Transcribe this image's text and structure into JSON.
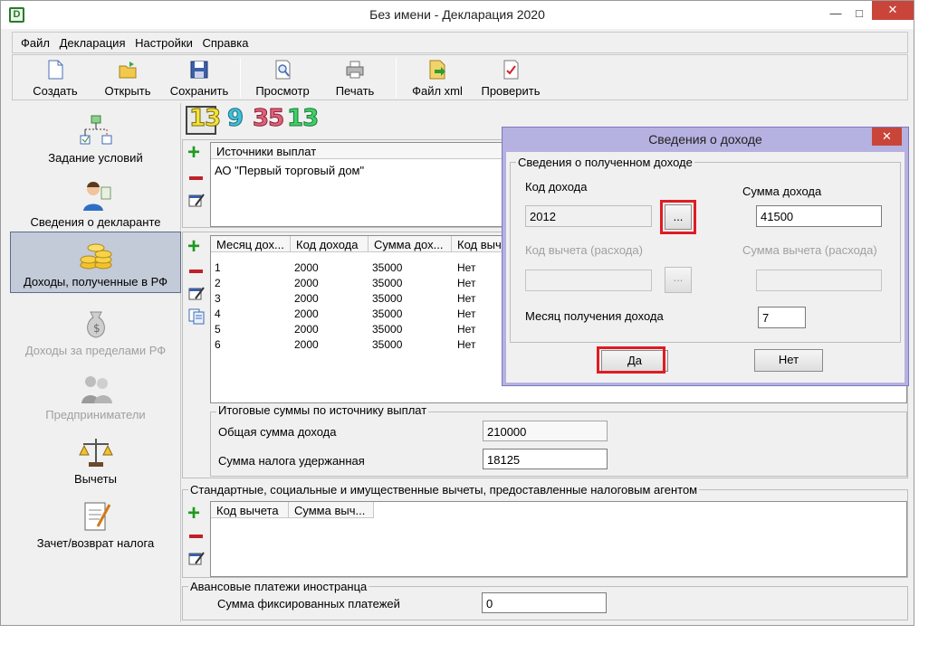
{
  "window": {
    "title": "Без имени - Декларация 2020",
    "app_icon": "D"
  },
  "menu": [
    "Файл",
    "Декларация",
    "Настройки",
    "Справка"
  ],
  "toolbar": {
    "create": "Создать",
    "open": "Открыть",
    "save": "Сохранить",
    "preview": "Просмотр",
    "print": "Печать",
    "xml": "Файл xml",
    "check": "Проверить"
  },
  "nav": [
    {
      "label": "Задание условий",
      "icon": "conditions-tree-icon",
      "state": "normal"
    },
    {
      "label": "Сведения о декларанте",
      "icon": "person-icon",
      "state": "normal"
    },
    {
      "label": "Доходы, полученные в РФ",
      "icon": "coins-icon",
      "state": "active"
    },
    {
      "label": "Доходы за пределами РФ",
      "icon": "money-bag-icon",
      "state": "disabled"
    },
    {
      "label": "Предприниматели",
      "icon": "businessmen-icon",
      "state": "disabled"
    },
    {
      "label": "Вычеты",
      "icon": "scales-icon",
      "state": "normal"
    },
    {
      "label": "Зачет/возврат налога",
      "icon": "document-pen-icon",
      "state": "normal"
    }
  ],
  "rate_tabs": [
    {
      "label": "13",
      "color": "#f2e23c",
      "selected": true
    },
    {
      "label": "9",
      "color": "#3fc0d8"
    },
    {
      "label": "35",
      "color": "#e0607a"
    },
    {
      "label": "13",
      "color": "#3fcf6a"
    }
  ],
  "sources": {
    "header": "Источники выплат",
    "rows": [
      "АО \"Первый торговый дом\""
    ]
  },
  "income_table": {
    "headers": [
      "Месяц дох...",
      "Код дохода",
      "Сумма дох...",
      "Код выч"
    ],
    "rows": [
      [
        "1",
        "2000",
        "35000",
        "Нет"
      ],
      [
        "2",
        "2000",
        "35000",
        "Нет"
      ],
      [
        "3",
        "2000",
        "35000",
        "Нет"
      ],
      [
        "4",
        "2000",
        "35000",
        "Нет"
      ],
      [
        "5",
        "2000",
        "35000",
        "Нет"
      ],
      [
        "6",
        "2000",
        "35000",
        "Нет"
      ]
    ]
  },
  "totals": {
    "group_title": "Итоговые суммы по источнику выплат",
    "income_label": "Общая сумма дохода",
    "income_value": "210000",
    "tax_label": "Сумма налога удержанная",
    "tax_value": "18125"
  },
  "deductions": {
    "group_title": "Стандартные, социальные и имущественные вычеты, предоставленные налоговым агентом",
    "headers": [
      "Код вычета",
      "Сумма выч..."
    ]
  },
  "advance": {
    "group_title": "Авансовые платежи иностранца",
    "label": "Сумма фиксированных платежей",
    "value": "0"
  },
  "dialog": {
    "title": "Сведения о доходе",
    "group_title": "Сведения о полученном доходе",
    "income_code_label": "Код дохода",
    "income_code_value": "2012",
    "browse": "...",
    "income_sum_label": "Сумма дохода",
    "income_sum_value": "41500",
    "deduction_code_label": "Код вычета (расхода)",
    "deduction_sum_label": "Сумма вычета (расхода)",
    "month_label": "Месяц получения дохода",
    "month_value": "7",
    "yes": "Да",
    "no": "Нет"
  },
  "colors": {
    "highlight": "#e01b24",
    "dialog_frame": "#b5b1e0",
    "active_nav": "#c3cad8"
  }
}
